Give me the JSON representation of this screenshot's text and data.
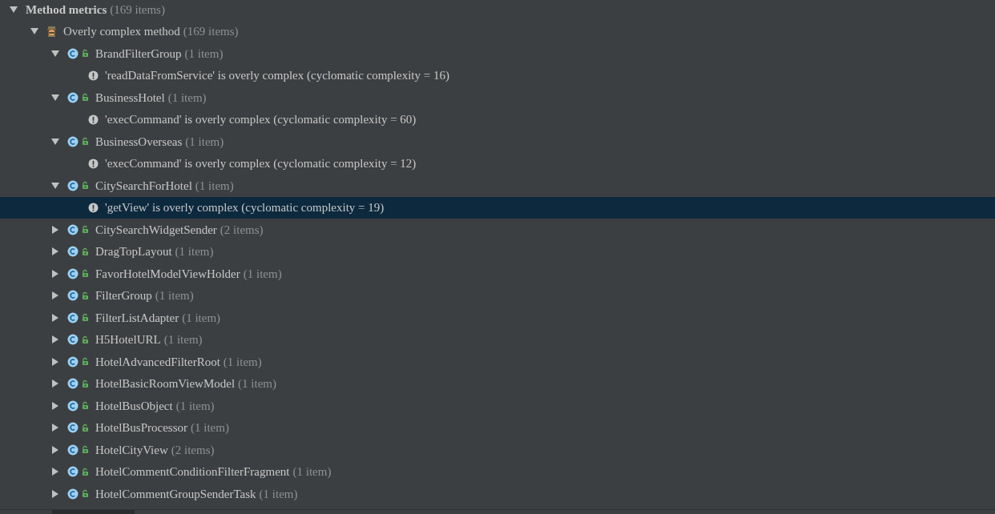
{
  "tree": [
    {
      "kind": "category",
      "label": "Method metrics",
      "count": "(169 items)",
      "expanded": true,
      "selected": false,
      "children": [
        {
          "kind": "inspection",
          "label": "Overly complex method",
          "count": "(169 items)",
          "expanded": true,
          "selected": false,
          "children": [
            {
              "kind": "class",
              "label": "BrandFilterGroup",
              "count": "(1 item)",
              "expanded": true,
              "selected": false,
              "children": [
                {
                  "kind": "problem",
                  "label": "'readDataFromService' is overly complex (cyclomatic complexity = 16)",
                  "selected": false
                }
              ]
            },
            {
              "kind": "class",
              "label": "BusinessHotel",
              "count": "(1 item)",
              "expanded": true,
              "selected": false,
              "children": [
                {
                  "kind": "problem",
                  "label": "'execCommand' is overly complex (cyclomatic complexity = 60)",
                  "selected": false
                }
              ]
            },
            {
              "kind": "class",
              "label": "BusinessOverseas",
              "count": "(1 item)",
              "expanded": true,
              "selected": false,
              "children": [
                {
                  "kind": "problem",
                  "label": "'execCommand' is overly complex (cyclomatic complexity = 12)",
                  "selected": false
                }
              ]
            },
            {
              "kind": "class",
              "label": "CitySearchForHotel",
              "count": "(1 item)",
              "expanded": true,
              "selected": false,
              "children": [
                {
                  "kind": "problem",
                  "label": "'getView' is overly complex (cyclomatic complexity = 19)",
                  "selected": true
                }
              ]
            },
            {
              "kind": "class",
              "label": "CitySearchWidgetSender",
              "count": "(2 items)",
              "expanded": false,
              "selected": false
            },
            {
              "kind": "class",
              "label": "DragTopLayout",
              "count": "(1 item)",
              "expanded": false,
              "selected": false
            },
            {
              "kind": "class",
              "label": "FavorHotelModelViewHolder",
              "count": "(1 item)",
              "expanded": false,
              "selected": false
            },
            {
              "kind": "class",
              "label": "FilterGroup",
              "count": "(1 item)",
              "expanded": false,
              "selected": false
            },
            {
              "kind": "class",
              "label": "FilterListAdapter",
              "count": "(1 item)",
              "expanded": false,
              "selected": false
            },
            {
              "kind": "class",
              "label": "H5HotelURL",
              "count": "(1 item)",
              "expanded": false,
              "selected": false
            },
            {
              "kind": "class",
              "label": "HotelAdvancedFilterRoot",
              "count": "(1 item)",
              "expanded": false,
              "selected": false
            },
            {
              "kind": "class",
              "label": "HotelBasicRoomViewModel",
              "count": "(1 item)",
              "expanded": false,
              "selected": false
            },
            {
              "kind": "class",
              "label": "HotelBusObject",
              "count": "(1 item)",
              "expanded": false,
              "selected": false
            },
            {
              "kind": "class",
              "label": "HotelBusProcessor",
              "count": "(1 item)",
              "expanded": false,
              "selected": false
            },
            {
              "kind": "class",
              "label": "HotelCityView",
              "count": "(2 items)",
              "expanded": false,
              "selected": false
            },
            {
              "kind": "class",
              "label": "HotelCommentConditionFilterFragment",
              "count": "(1 item)",
              "expanded": false,
              "selected": false
            },
            {
              "kind": "class",
              "label": "HotelCommentGroupSenderTask",
              "count": "(1 item)",
              "expanded": false,
              "selected": false
            }
          ]
        }
      ]
    }
  ]
}
